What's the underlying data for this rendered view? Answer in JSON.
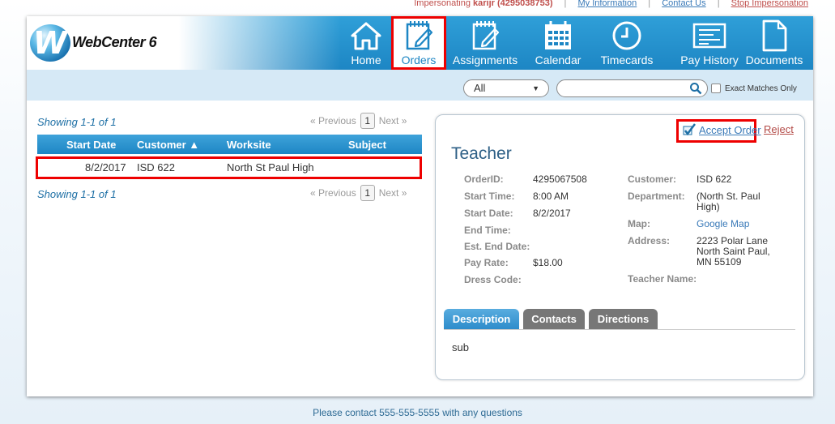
{
  "topbar": {
    "impersonating_prefix": "Impersonating",
    "impersonating_user": "karijr (4295038753)",
    "my_information": "My Information",
    "contact_us": "Contact Us",
    "stop_impersonation": "Stop Impersonation"
  },
  "logo": {
    "mark": "W",
    "name": "WebCenter 6"
  },
  "nav": [
    {
      "label": "Home",
      "icon": "home-icon",
      "selected": false
    },
    {
      "label": "Orders",
      "icon": "orders-icon",
      "selected": true
    },
    {
      "label": "Assignments",
      "icon": "assignments-icon",
      "selected": false
    },
    {
      "label": "Calendar",
      "icon": "calendar-icon",
      "selected": false
    },
    {
      "label": "Timecards",
      "icon": "clock-icon",
      "selected": false
    },
    {
      "label": "Pay History",
      "icon": "pay-history-icon",
      "selected": false
    },
    {
      "label": "Documents",
      "icon": "document-icon",
      "selected": false
    }
  ],
  "search": {
    "filter_value": "All",
    "query": "",
    "exact_matches_label": "Exact Matches Only"
  },
  "list": {
    "showing": "Showing 1-1 of 1",
    "previous": "« Previous",
    "page": "1",
    "next": "Next »",
    "columns": [
      "Start Date",
      "Customer ▲",
      "Worksite",
      "Subject"
    ],
    "rows": [
      {
        "start_date": "8/2/2017",
        "customer": "ISD 622",
        "worksite": "North St Paul High",
        "subject": ""
      }
    ]
  },
  "detail": {
    "accept": "Accept Order",
    "reject": "Reject",
    "title": "Teacher",
    "left_fields": [
      {
        "label": "OrderID:",
        "value": "4295067508"
      },
      {
        "label": "Start Time:",
        "value": "8:00 AM"
      },
      {
        "label": "Start Date:",
        "value": "8/2/2017"
      },
      {
        "label": "End Time:",
        "value": ""
      },
      {
        "label": "Est. End Date:",
        "value": ""
      },
      {
        "label": "Pay Rate:",
        "value": "$18.00"
      },
      {
        "label": "Dress Code:",
        "value": ""
      }
    ],
    "right_fields": [
      {
        "label": "Customer:",
        "value": "ISD 622"
      },
      {
        "label": "Department:",
        "value": "(North St. Paul High)"
      },
      {
        "label": "Map:",
        "value": "Google Map"
      },
      {
        "label": "Address:",
        "value": "2223 Polar Lane North Saint Paul, MN 55109"
      },
      {
        "label": "Teacher Name:",
        "value": ""
      }
    ],
    "tabs": [
      "Description",
      "Contacts",
      "Directions"
    ],
    "description": "sub"
  },
  "footer": "Please contact 555-555-5555 with any questions",
  "colors": {
    "header_blue": "#1d86c4",
    "highlight_red": "#e00000",
    "reject_red": "#b34b47"
  }
}
